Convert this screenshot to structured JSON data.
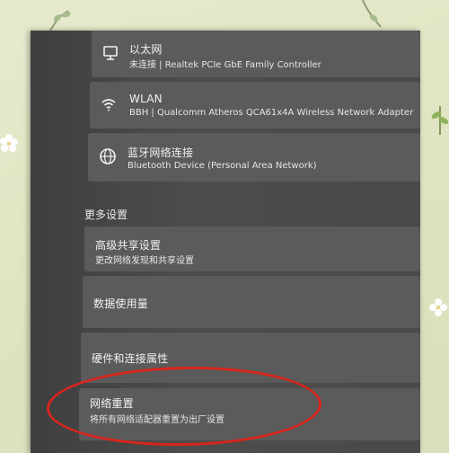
{
  "network_adapters": [
    {
      "icon": "ethernet-icon",
      "name": "以太网",
      "detail": "未连接 | Realtek PCIe GbE Family Controller"
    },
    {
      "icon": "wifi-icon",
      "name": "WLAN",
      "detail": "BBH | Qualcomm Atheros QCA61x4A Wireless Network Adapter"
    },
    {
      "icon": "bluetooth-network-icon",
      "name": "蓝牙网络连接",
      "detail": "Bluetooth Device (Personal Area Network)"
    }
  ],
  "more_settings": {
    "heading": "更多设置",
    "items": [
      {
        "title": "高级共享设置",
        "subtitle": "更改网络发现和共享设置"
      },
      {
        "title": "数据使用量",
        "subtitle": ""
      },
      {
        "title": "硬件和连接属性",
        "subtitle": ""
      },
      {
        "title": "网络重置",
        "subtitle": "将所有网络适配器重置为出厂设置"
      }
    ]
  },
  "colors": {
    "highlight_circle": "#d8251d",
    "panel_background": "#5b5b5b"
  }
}
